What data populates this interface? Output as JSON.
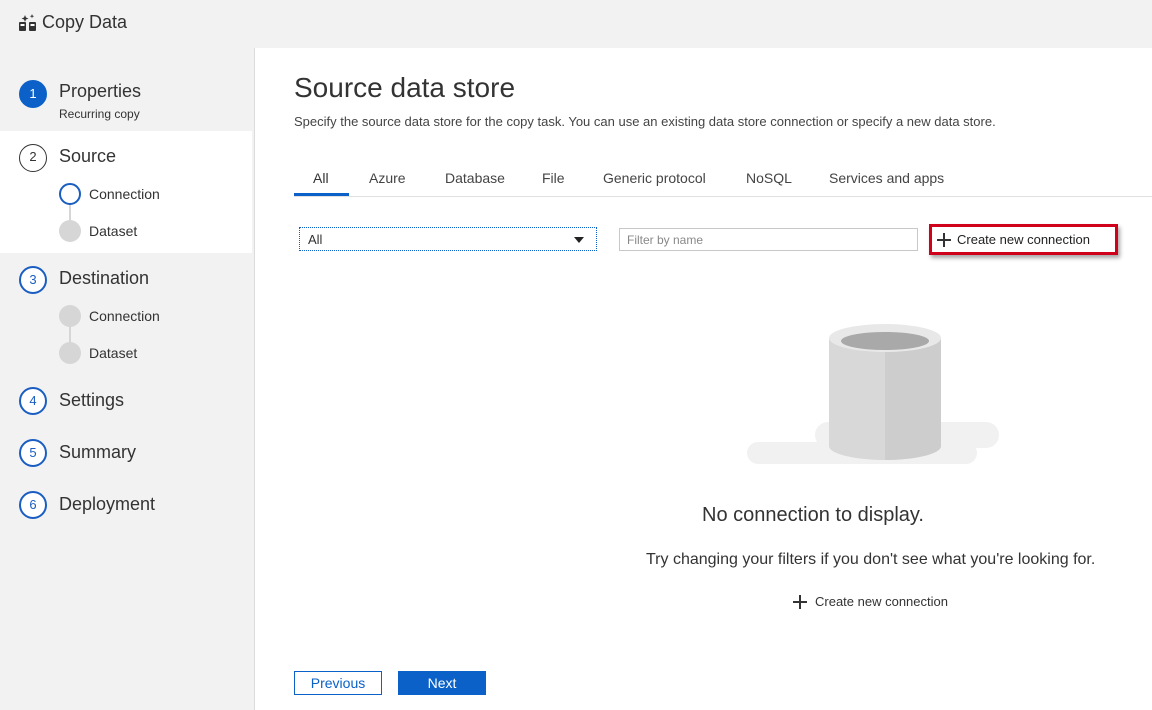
{
  "app": {
    "title": "Copy Data"
  },
  "steps": [
    {
      "number": "1",
      "label": "Properties",
      "sub": "Recurring copy",
      "state": "active"
    },
    {
      "number": "2",
      "label": "Source",
      "substeps": [
        "Connection",
        "Dataset"
      ]
    },
    {
      "number": "3",
      "label": "Destination",
      "substeps": [
        "Connection",
        "Dataset"
      ]
    },
    {
      "number": "4",
      "label": "Settings"
    },
    {
      "number": "5",
      "label": "Summary"
    },
    {
      "number": "6",
      "label": "Deployment"
    }
  ],
  "main": {
    "title": "Source data store",
    "description": "Specify the source data store for the copy task. You can use an existing data store connection or specify a new data store.",
    "tabs": [
      "All",
      "Azure",
      "Database",
      "File",
      "Generic protocol",
      "NoSQL",
      "Services and apps"
    ],
    "active_tab": "All",
    "filter_select": {
      "value": "All"
    },
    "filter_input": {
      "placeholder": "Filter by name",
      "value": ""
    },
    "create_button_label": "Create new connection",
    "empty": {
      "title": "No connection to display.",
      "hint": "Try changing your filters if you don't see what you're looking for.",
      "link_label": "Create new connection"
    }
  },
  "footer": {
    "previous_label": "Previous",
    "next_label": "Next"
  },
  "colors": {
    "accent": "#0b61c8",
    "highlight": "#d0021b",
    "sidebar_bg": "#f2f2f2"
  }
}
